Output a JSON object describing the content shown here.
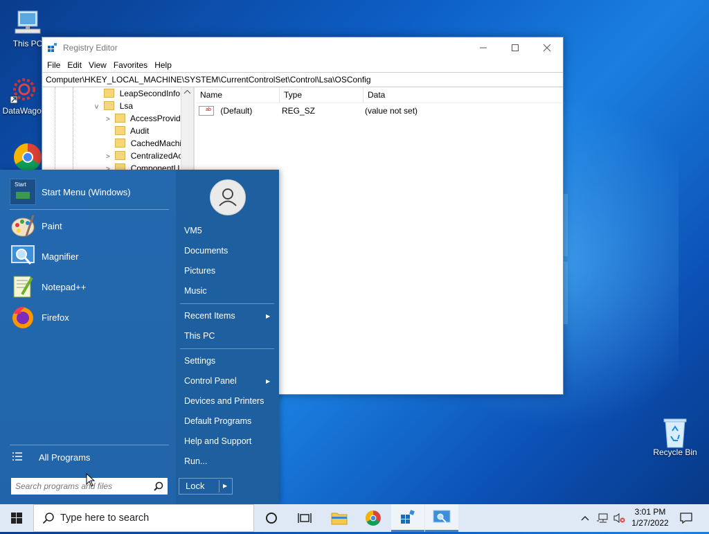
{
  "desktop": {
    "icons": [
      {
        "label": "This PC",
        "icon": "computer-icon"
      },
      {
        "label": "DataWagon",
        "icon": "gear-app-icon"
      },
      {
        "label": "",
        "icon": "chrome-icon"
      },
      {
        "label": "Recycle Bin",
        "icon": "recycle-bin-icon"
      }
    ]
  },
  "regedit": {
    "title": "Registry Editor",
    "menu": [
      "File",
      "Edit",
      "View",
      "Favorites",
      "Help"
    ],
    "address": "Computer\\HKEY_LOCAL_MACHINE\\SYSTEM\\CurrentControlSet\\Control\\Lsa\\OSConfig",
    "tree": [
      {
        "label": "LeapSecondInfor",
        "expander": ""
      },
      {
        "label": "Lsa",
        "expander": "v"
      },
      {
        "label": "AccessProvide",
        "expander": ">"
      },
      {
        "label": "Audit",
        "expander": ""
      },
      {
        "label": "CachedMachi",
        "expander": ""
      },
      {
        "label": "CentralizedAc",
        "expander": ">"
      },
      {
        "label": "ComponentU",
        "expander": ">"
      }
    ],
    "columns": [
      "Name",
      "Type",
      "Data"
    ],
    "rows": [
      {
        "name": "(Default)",
        "type": "REG_SZ",
        "data": "(value not set)"
      }
    ]
  },
  "start_menu": {
    "programs": [
      {
        "label": "Start Menu (Windows)",
        "icon": "start-menu-app-icon"
      },
      {
        "label": "Paint",
        "icon": "paint-icon"
      },
      {
        "label": "Magnifier",
        "icon": "magnifier-icon"
      },
      {
        "label": "Notepad++",
        "icon": "notepad-plus-plus-icon"
      },
      {
        "label": "Firefox",
        "icon": "firefox-icon"
      }
    ],
    "start_icon_text": "Start",
    "all_programs": "All Programs",
    "search_placeholder": "Search programs and files",
    "right_items": {
      "user": "VM5",
      "documents": "Documents",
      "pictures": "Pictures",
      "music": "Music",
      "recent": "Recent Items",
      "thispc": "This PC",
      "settings": "Settings",
      "control_panel": "Control Panel",
      "devices": "Devices and Printers",
      "default_programs": "Default Programs",
      "help": "Help and Support",
      "run": "Run..."
    },
    "lock_label": "Lock"
  },
  "taskbar": {
    "search_placeholder": "Type here to search",
    "time": "3:01 PM",
    "date": "1/27/2022",
    "colors": {
      "accent": "#4a7fc1",
      "bar": "#dfe9f5"
    }
  }
}
